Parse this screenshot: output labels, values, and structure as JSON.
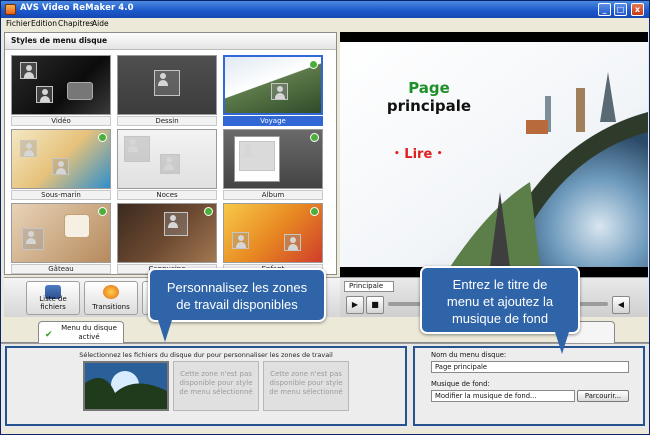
{
  "window": {
    "title": "AVS Video ReMaker 4.0",
    "controls": [
      "_",
      "□",
      "x"
    ]
  },
  "menu": [
    "Fichier",
    "Edition",
    "Chapitres",
    "Aide"
  ],
  "styles_panel": {
    "title": "Styles de menu disque",
    "tiles": [
      {
        "label": "Vidéo"
      },
      {
        "label": "Dessin"
      },
      {
        "label": "Voyage",
        "selected": true
      },
      {
        "label": "Sous-marin"
      },
      {
        "label": "Noces"
      },
      {
        "label": "Album"
      },
      {
        "label": "Gâteau"
      },
      {
        "label": "Cappucino"
      },
      {
        "label": "Enfant"
      }
    ]
  },
  "preview": {
    "title_line1": "Page",
    "title_line2": "principale",
    "play_label": "Lire",
    "colors": {
      "title_green": "#1f8f2a",
      "play_red": "#e02020"
    }
  },
  "timeline": {
    "tab_label": "Principale",
    "play_icon": "play-icon",
    "stop_icon": "stop-icon",
    "volume_icon": "speaker-icon"
  },
  "toolbar": {
    "buttons": [
      {
        "label": "Liste de fichiers",
        "icon": "film-icon"
      },
      {
        "label": "Transitions",
        "icon": "transitions-icon"
      }
    ]
  },
  "tabs": {
    "active_line1": "Menu du disque",
    "active_line2": "activé"
  },
  "zones": {
    "description": "Sélectionnez les fichiers du disque dur pour personnaliser les zones de travail",
    "unavailable_text": "Cette zone n'est pas disponible pour style de menu sélectionné"
  },
  "form": {
    "menu_name_label": "Nom du menu disque:",
    "menu_name_value": "Page principale",
    "music_label": "Musique de fond:",
    "music_value": "Modifier la musique de fond...",
    "browse_button": "Parcourir..."
  },
  "callouts": {
    "left_line1": "Personnalisez les zones",
    "left_line2": "de travail disponibles",
    "right_line1": "Entrez le titre de",
    "right_line2": "menu et ajoutez la",
    "right_line3": "musique de fond",
    "color": "#2f64a9"
  }
}
